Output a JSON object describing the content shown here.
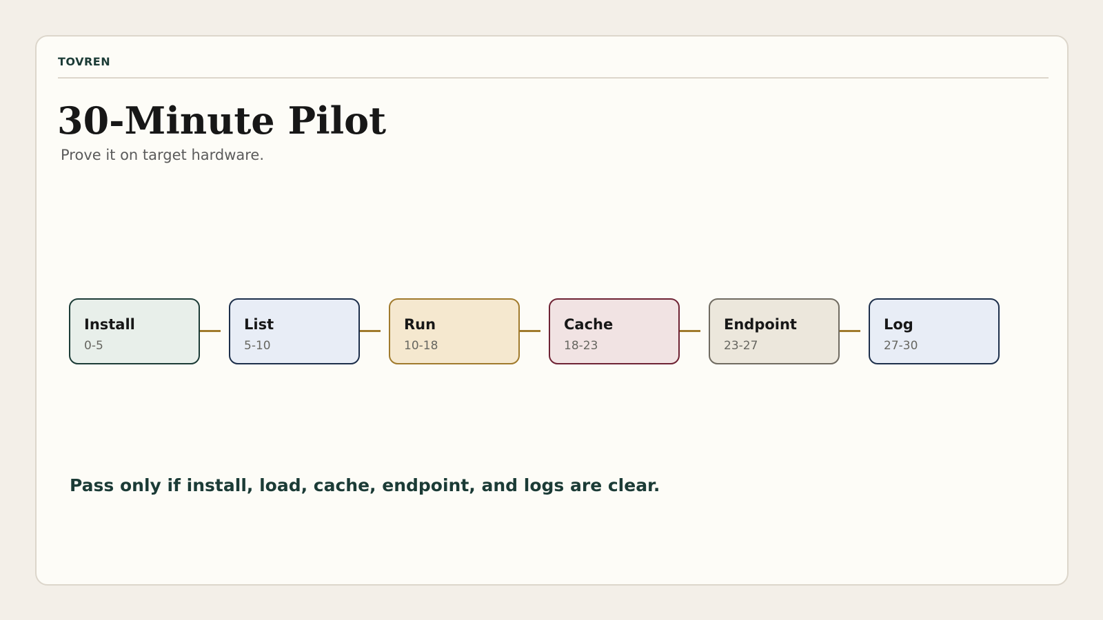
{
  "brand": "TOVREN",
  "title": "30-Minute Pilot",
  "subtitle": "Prove it on target hardware.",
  "stages": [
    {
      "name": "Install",
      "range": "0-5",
      "fill": "#e8efea",
      "border": "#1b3b36"
    },
    {
      "name": "List",
      "range": "5-10",
      "fill": "#e8edf6",
      "border": "#1c2e4a"
    },
    {
      "name": "Run",
      "range": "10-18",
      "fill": "#f5e8cf",
      "border": "#a07a2c"
    },
    {
      "name": "Cache",
      "range": "18-23",
      "fill": "#f1e3e3",
      "border": "#6e2233"
    },
    {
      "name": "Endpoint",
      "range": "23-27",
      "fill": "#ece7dc",
      "border": "#6f6a60"
    },
    {
      "name": "Log",
      "range": "27-30",
      "fill": "#e8edf6",
      "border": "#1c2e4a"
    }
  ],
  "connector_color": "#a07a2c",
  "footnote": "Pass only if install, load, cache, endpoint, and logs are clear."
}
